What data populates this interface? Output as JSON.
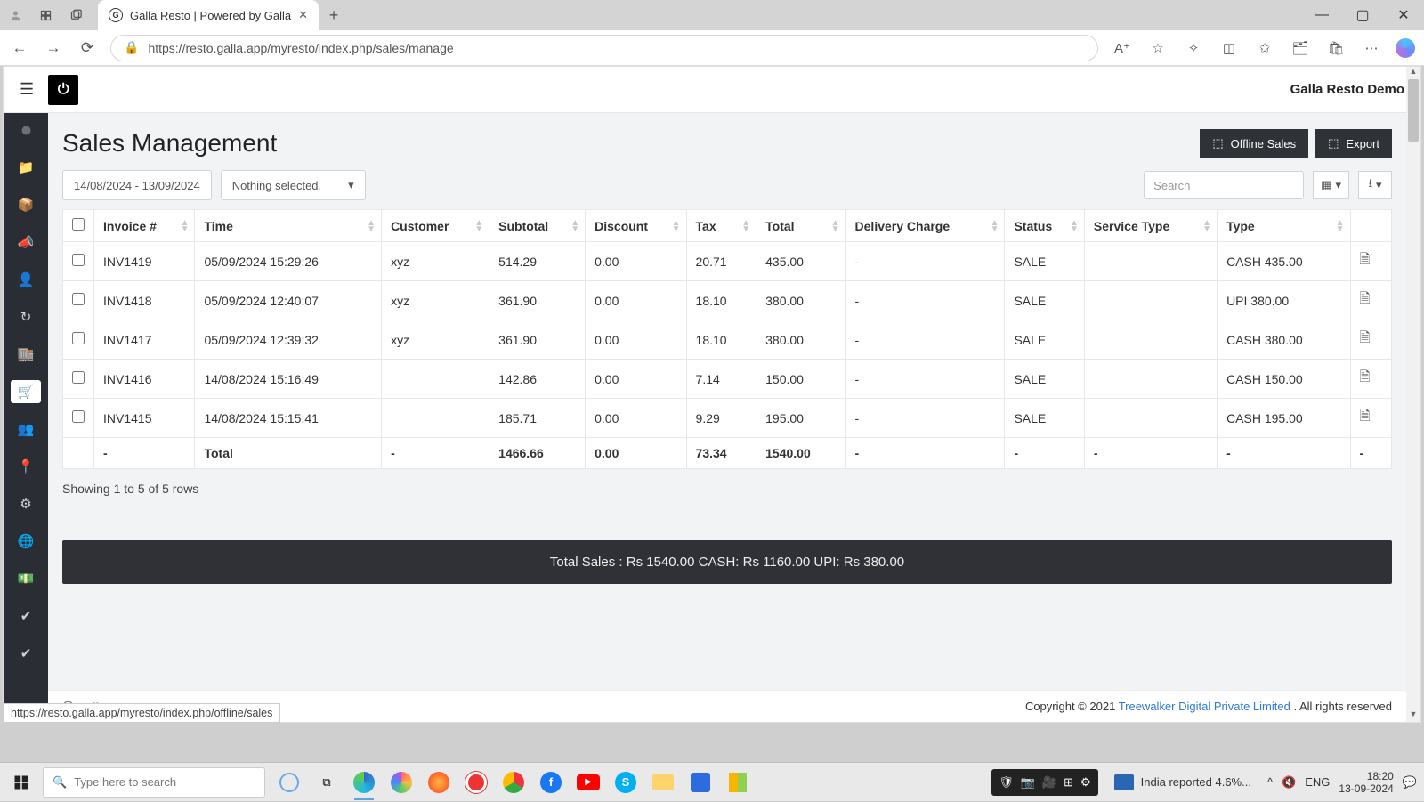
{
  "browser": {
    "tab_title": "Galla Resto | Powered by Galla",
    "url": "https://resto.galla.app/myresto/index.php/sales/manage",
    "status_hover": "https://resto.galla.app/myresto/index.php/offline/sales"
  },
  "app": {
    "tenant": "Galla Resto Demo",
    "page_title": "Sales Management",
    "btn_offline": "Offline Sales",
    "btn_export": "Export",
    "date_range": "14/08/2024 - 13/09/2024",
    "filter_select": "Nothing selected.",
    "search_placeholder": "Search"
  },
  "table": {
    "headers": {
      "invoice": "Invoice #",
      "time": "Time",
      "customer": "Customer",
      "subtotal": "Subtotal",
      "discount": "Discount",
      "tax": "Tax",
      "total": "Total",
      "delivery": "Delivery Charge",
      "status": "Status",
      "service": "Service Type",
      "type": "Type"
    },
    "rows": [
      {
        "inv": "INV1419",
        "time": "05/09/2024 15:29:26",
        "cust": "xyz",
        "sub": "514.29",
        "disc": "0.00",
        "tax": "20.71",
        "tot": "435.00",
        "del": "-",
        "stat": "SALE",
        "serv": "",
        "type": "CASH 435.00"
      },
      {
        "inv": "INV1418",
        "time": "05/09/2024 12:40:07",
        "cust": "xyz",
        "sub": "361.90",
        "disc": "0.00",
        "tax": "18.10",
        "tot": "380.00",
        "del": "-",
        "stat": "SALE",
        "serv": "",
        "type": "UPI 380.00"
      },
      {
        "inv": "INV1417",
        "time": "05/09/2024 12:39:32",
        "cust": "xyz",
        "sub": "361.90",
        "disc": "0.00",
        "tax": "18.10",
        "tot": "380.00",
        "del": "-",
        "stat": "SALE",
        "serv": "",
        "type": "CASH 380.00"
      },
      {
        "inv": "INV1416",
        "time": "14/08/2024 15:16:49",
        "cust": "",
        "sub": "142.86",
        "disc": "0.00",
        "tax": "7.14",
        "tot": "150.00",
        "del": "-",
        "stat": "SALE",
        "serv": "",
        "type": "CASH 150.00"
      },
      {
        "inv": "INV1415",
        "time": "14/08/2024 15:15:41",
        "cust": "",
        "sub": "185.71",
        "disc": "0.00",
        "tax": "9.29",
        "tot": "195.00",
        "del": "-",
        "stat": "SALE",
        "serv": "",
        "type": "CASH 195.00"
      }
    ],
    "totalrow": {
      "label": "Total",
      "inv": "-",
      "cust": "-",
      "sub": "1466.66",
      "disc": "0.00",
      "tax": "73.34",
      "tot": "1540.00",
      "del": "-",
      "stat": "-",
      "serv": "-",
      "type": "-",
      "act": "-"
    },
    "showing": "Showing 1 to 5 of 5 rows"
  },
  "summary": "Total Sales : Rs 1540.00  CASH: Rs 1160.00  UPI: Rs 380.00",
  "footer": {
    "copyright": "Copyright © 2021 ",
    "company": "Treewalker Digital Private Limited",
    "tail": ". All rights reserved"
  },
  "taskbar": {
    "search_placeholder": "Type here to search",
    "news": "India reported 4.6%...",
    "lang": "ENG",
    "time": "18:20",
    "date": "13-09-2024"
  }
}
